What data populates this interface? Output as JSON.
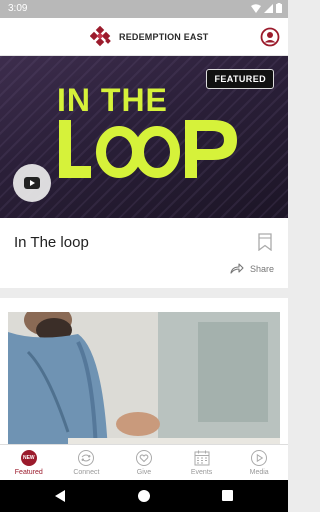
{
  "status_bar": {
    "time": "3:09"
  },
  "header": {
    "brand": "REDEMPTION EAST"
  },
  "featured_card": {
    "badge": "FEATURED",
    "hero_line1": "IN THE",
    "hero_line2": "LOOP",
    "title": "In The loop",
    "share_label": "Share"
  },
  "bottom_nav": {
    "new_badge": "NEW",
    "items": [
      {
        "label": "Featured",
        "icon": "new-badge-icon",
        "active": true
      },
      {
        "label": "Connect",
        "icon": "connect-icon",
        "active": false
      },
      {
        "label": "Give",
        "icon": "heart-icon",
        "active": false
      },
      {
        "label": "Events",
        "icon": "calendar-icon",
        "active": false
      },
      {
        "label": "Media",
        "icon": "play-circle-icon",
        "active": false
      }
    ]
  },
  "colors": {
    "accent": "#9b1b2c",
    "hero_text": "#d6f23a"
  }
}
